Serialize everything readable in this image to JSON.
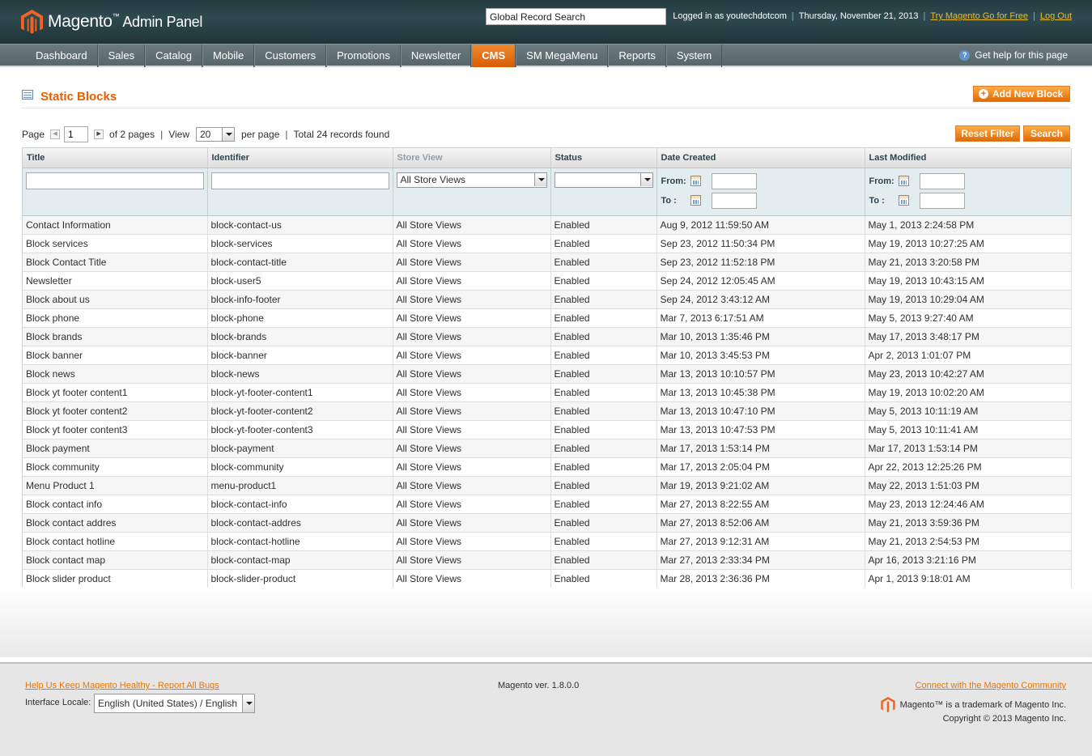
{
  "header": {
    "logo_brand": "Magento",
    "logo_tm": "™",
    "logo_panel": "Admin Panel",
    "search_value": "Global Record Search",
    "logged_in": "Logged in as youtechdotcom",
    "date": "Thursday, November 21, 2013",
    "try_link": "Try Magento Go for Free",
    "logout_link": "Log Out"
  },
  "nav": {
    "items": [
      "Dashboard",
      "Sales",
      "Catalog",
      "Mobile",
      "Customers",
      "Promotions",
      "Newsletter",
      "CMS",
      "SM MegaMenu",
      "Reports",
      "System"
    ],
    "active": "CMS",
    "help": "Get help for this page"
  },
  "page": {
    "title": "Static Blocks",
    "add_button": "Add New Block"
  },
  "pager": {
    "page_label": "Page",
    "page_value": "1",
    "of_pages": "of 2 pages",
    "view_label": "View",
    "view_value": "20",
    "per_page": "per page",
    "total": "Total 24 records found",
    "reset_button": "Reset Filter",
    "search_button": "Search"
  },
  "grid": {
    "columns": [
      "Title",
      "Identifier",
      "Store View",
      "Status",
      "Date Created",
      "Last Modified"
    ],
    "filter": {
      "store_view": "All Store Views",
      "status": "",
      "from_label": "From:",
      "to_label": "To :"
    },
    "rows": [
      [
        "Contact Information",
        "block-contact-us",
        "All Store Views",
        "Enabled",
        "Aug 9, 2012 11:59:50 AM",
        "May 1, 2013 2:24:58 PM"
      ],
      [
        "Block services",
        "block-services",
        "All Store Views",
        "Enabled",
        "Sep 23, 2012 11:50:34 PM",
        "May 19, 2013 10:27:25 AM"
      ],
      [
        "Block Contact Title",
        "block-contact-title",
        "All Store Views",
        "Enabled",
        "Sep 23, 2012 11:52:18 PM",
        "May 21, 2013 3:20:58 PM"
      ],
      [
        "Newsletter",
        "block-user5",
        "All Store Views",
        "Enabled",
        "Sep 24, 2012 12:05:45 AM",
        "May 19, 2013 10:43:15 AM"
      ],
      [
        "Block about us",
        "block-info-footer",
        "All Store Views",
        "Enabled",
        "Sep 24, 2012 3:43:12 AM",
        "May 19, 2013 10:29:04 AM"
      ],
      [
        "Block phone",
        "block-phone",
        "All Store Views",
        "Enabled",
        "Mar 7, 2013 6:17:51 AM",
        "May 5, 2013 9:27:40 AM"
      ],
      [
        "Block brands",
        "block-brands",
        "All Store Views",
        "Enabled",
        "Mar 10, 2013 1:35:46 PM",
        "May 17, 2013 3:48:17 PM"
      ],
      [
        "Block banner",
        "block-banner",
        "All Store Views",
        "Enabled",
        "Mar 10, 2013 3:45:53 PM",
        "Apr 2, 2013 1:01:07 PM"
      ],
      [
        "Block news",
        "block-news",
        "All Store Views",
        "Enabled",
        "Mar 13, 2013 10:10:57 PM",
        "May 23, 2013 10:42:27 AM"
      ],
      [
        "Block yt footer content1",
        "block-yt-footer-content1",
        "All Store Views",
        "Enabled",
        "Mar 13, 2013 10:45:38 PM",
        "May 19, 2013 10:02:20 AM"
      ],
      [
        "Block yt footer content2",
        "block-yt-footer-content2",
        "All Store Views",
        "Enabled",
        "Mar 13, 2013 10:47:10 PM",
        "May 5, 2013 10:11:19 AM"
      ],
      [
        "Block yt footer content3",
        "block-yt-footer-content3",
        "All Store Views",
        "Enabled",
        "Mar 13, 2013 10:47:53 PM",
        "May 5, 2013 10:11:41 AM"
      ],
      [
        "Block payment",
        "block-payment",
        "All Store Views",
        "Enabled",
        "Mar 17, 2013 1:53:14 PM",
        "Mar 17, 2013 1:53:14 PM"
      ],
      [
        "Block community",
        "block-community",
        "All Store Views",
        "Enabled",
        "Mar 17, 2013 2:05:04 PM",
        "Apr 22, 2013 12:25:26 PM"
      ],
      [
        "Menu Product 1",
        "menu-product1",
        "All Store Views",
        "Enabled",
        "Mar 19, 2013 9:21:02 AM",
        "May 22, 2013 1:51:03 PM"
      ],
      [
        "Block contact info",
        "block-contact-info",
        "All Store Views",
        "Enabled",
        "Mar 27, 2013 8:22:55 AM",
        "May 23, 2013 12:24:46 AM"
      ],
      [
        "Block contact addres",
        "block-contact-addres",
        "All Store Views",
        "Enabled",
        "Mar 27, 2013 8:52:06 AM",
        "May 21, 2013 3:59:36 PM"
      ],
      [
        "Block contact hotline",
        "block-contact-hotline",
        "All Store Views",
        "Enabled",
        "Mar 27, 2013 9:12:31 AM",
        "May 21, 2013 2:54:53 PM"
      ],
      [
        "Block contact map",
        "block-contact-map",
        "All Store Views",
        "Enabled",
        "Mar 27, 2013 2:33:34 PM",
        "Apr 16, 2013 3:21:16 PM"
      ],
      [
        "Block slider product",
        "block-slider-product",
        "All Store Views",
        "Enabled",
        "Mar 28, 2013 2:36:36 PM",
        "Apr 1, 2013 9:18:01 AM"
      ]
    ]
  },
  "footer": {
    "bugs_link": "Help Us Keep Magento Healthy - Report All Bugs",
    "locale_label": "Interface Locale:",
    "locale_value": "English (United States) / English",
    "version": "Magento ver. 1.8.0.0",
    "community_link": "Connect with the Magento Community",
    "trademark": "Magento™ is a trademark of Magento Inc.",
    "copyright": "Copyright © 2013 Magento Inc."
  },
  "colors": {
    "accent": "#eb5e00",
    "header_bg": "#2e4a50",
    "nav_bg": "#5f6f73",
    "link": "#ea7601"
  },
  "icons": [
    "magento-logo-icon",
    "help-icon",
    "grid-icon",
    "plus-icon",
    "calendar-icon",
    "chevron-down-icon",
    "arrow-left-icon",
    "arrow-right-icon"
  ]
}
